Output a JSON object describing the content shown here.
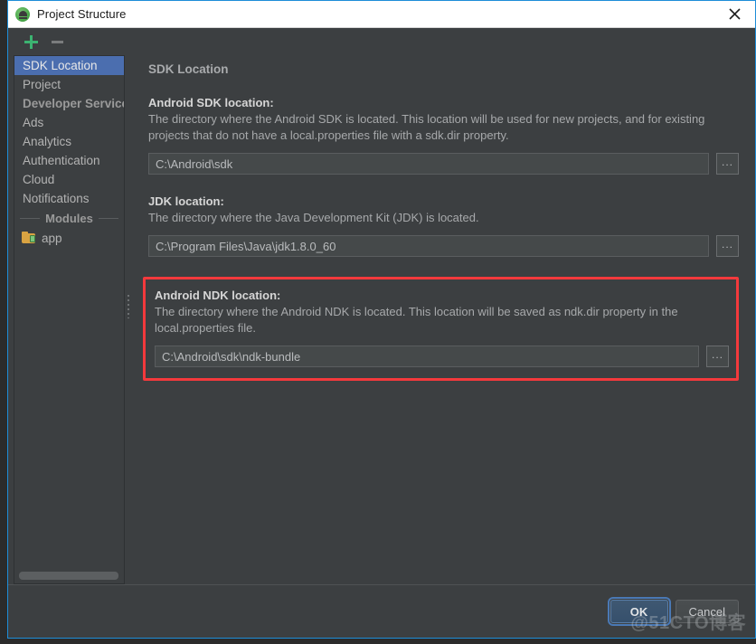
{
  "window": {
    "title": "Project Structure",
    "app_icon": "android-studio-icon",
    "close_icon": "close-icon"
  },
  "sidebar": {
    "toolbar": {
      "add_icon": "plus-icon",
      "remove_icon": "minus-icon"
    },
    "items": [
      {
        "label": "SDK Location",
        "selected": true,
        "type": "item"
      },
      {
        "label": "Project",
        "selected": false,
        "type": "item"
      },
      {
        "label": "Developer Services",
        "selected": false,
        "type": "group"
      },
      {
        "label": "Ads",
        "selected": false,
        "type": "item"
      },
      {
        "label": "Analytics",
        "selected": false,
        "type": "item"
      },
      {
        "label": "Authentication",
        "selected": false,
        "type": "item"
      },
      {
        "label": "Cloud",
        "selected": false,
        "type": "item"
      },
      {
        "label": "Notifications",
        "selected": false,
        "type": "item"
      }
    ],
    "modules_separator": "Modules",
    "modules": [
      {
        "label": "app",
        "icon": "module-folder-icon"
      }
    ]
  },
  "main": {
    "panel_title": "SDK Location",
    "sections": [
      {
        "label": "Android SDK location:",
        "description": "The directory where the Android SDK is located. This location will be used for new projects, and for existing projects that do not have a local.properties file with a sdk.dir property.",
        "value": "C:\\Android\\sdk",
        "browse_label": "...",
        "highlighted": false
      },
      {
        "label": "JDK location:",
        "description": "The directory where the Java Development Kit (JDK) is located.",
        "value": "C:\\Program Files\\Java\\jdk1.8.0_60",
        "browse_label": "...",
        "highlighted": false
      },
      {
        "label": "Android NDK location:",
        "description": "The directory where the Android NDK is located. This location will be saved as ndk.dir property in the local.properties file.",
        "value": "C:\\Android\\sdk\\ndk-bundle",
        "browse_label": "...",
        "highlighted": true
      }
    ]
  },
  "footer": {
    "ok_label": "OK",
    "cancel_label": "Cancel",
    "watermark": "@51CTO博客"
  },
  "colors": {
    "accent_selection": "#4b6eaf",
    "highlight_box": "#f4393c",
    "window_border": "#1d8dd8",
    "panel_bg": "#3c3f41",
    "add_icon": "#3cb371"
  }
}
